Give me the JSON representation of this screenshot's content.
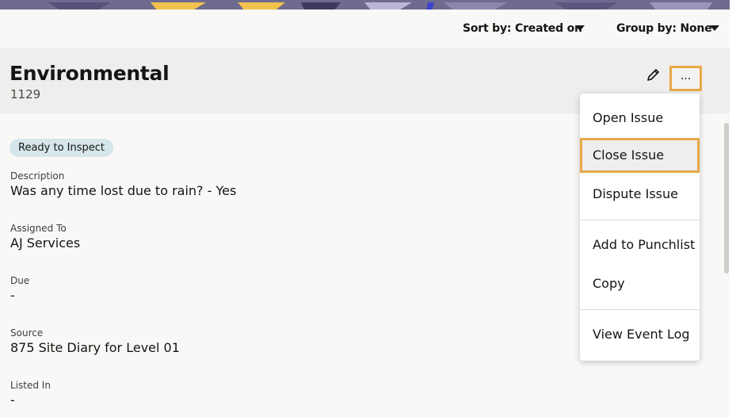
{
  "toolbar": {
    "sort_label": "Sort by: Created on",
    "group_label": "Group by: None"
  },
  "issue": {
    "title": "Environmental",
    "number": "1129",
    "status": "Ready to Inspect",
    "more_label": "..."
  },
  "fields": [
    {
      "label": "Description",
      "value": "Was any time lost due to rain? - Yes"
    },
    {
      "label": "Assigned To",
      "value": "AJ Services"
    },
    {
      "label": "Due",
      "value": "-"
    },
    {
      "label": "Source",
      "value": "875 Site Diary for Level 01"
    },
    {
      "label": "Listed In",
      "value": "-"
    }
  ],
  "menu": {
    "items": [
      {
        "label": "Open Issue"
      },
      {
        "label": "Close Issue",
        "selected": true
      },
      {
        "label": "Dispute Issue"
      },
      {
        "label": "Add to Punchlist"
      },
      {
        "label": "Copy"
      },
      {
        "label": "View Event Log"
      }
    ]
  },
  "icons": {
    "edit": "pencil-icon",
    "sort_caret": "caret-down-icon",
    "group_caret": "caret-down-icon"
  },
  "colors": {
    "highlight": "#e8a849",
    "badge_bg": "#d6e6ea",
    "header_bg": "#efeeec"
  }
}
